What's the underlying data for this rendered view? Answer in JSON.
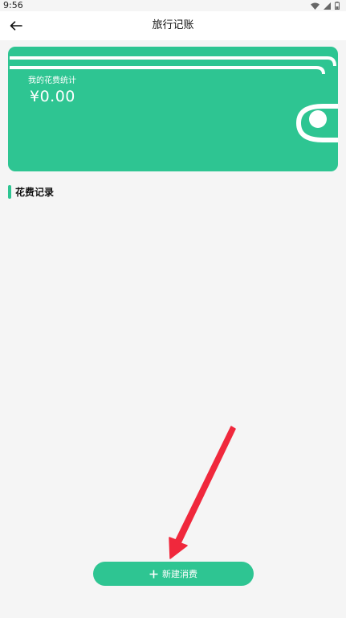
{
  "status_bar": {
    "time": "9:56"
  },
  "app_bar": {
    "title": "旅行记账"
  },
  "wallet": {
    "label": "我的花费统计",
    "amount": "¥0.00"
  },
  "section": {
    "title": "花费记录"
  },
  "actions": {
    "new_expense_label": "新建消费"
  },
  "colors": {
    "accent": "#2ec592",
    "background": "#f5f5f5",
    "arrow": "#f0283c"
  },
  "icons": [
    "back-arrow-icon",
    "plus-icon",
    "wifi-icon",
    "signal-icon",
    "battery-icon"
  ]
}
